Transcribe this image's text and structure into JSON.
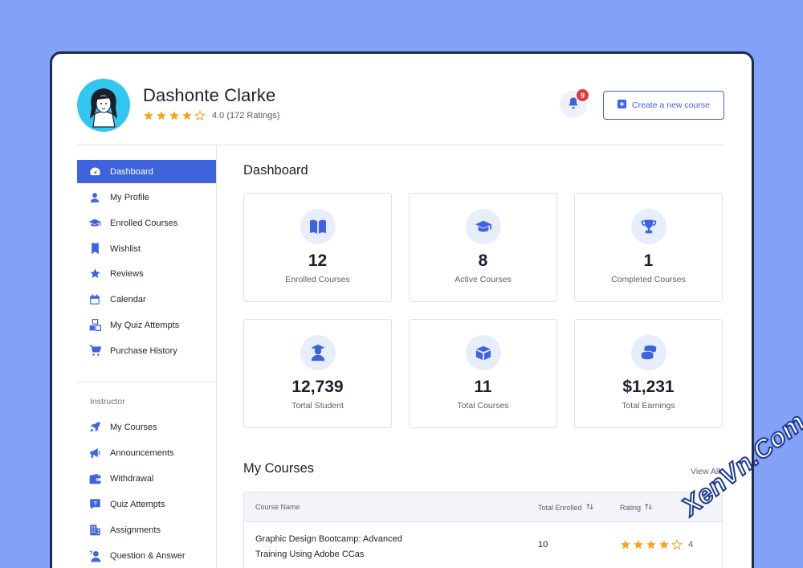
{
  "profile": {
    "name": "Dashonte Clarke",
    "rating_value": 4.0,
    "rating_text": "4.0 (172 Ratings)",
    "avatar_icon": "person-avatar-icon"
  },
  "header": {
    "notification_count": "9",
    "create_course_label": "Create a new course"
  },
  "sidebar": {
    "items": [
      {
        "label": "Dashboard",
        "icon": "gauge-icon",
        "active": true
      },
      {
        "label": "My Profile",
        "icon": "user-icon"
      },
      {
        "label": "Enrolled Courses",
        "icon": "graduation-cap-icon"
      },
      {
        "label": "Wishlist",
        "icon": "bookmark-icon"
      },
      {
        "label": "Reviews",
        "icon": "star-icon"
      },
      {
        "label": "Calendar",
        "icon": "calendar-icon"
      },
      {
        "label": "My Quiz Attempts",
        "icon": "cubes-icon"
      },
      {
        "label": "Purchase History",
        "icon": "cart-icon"
      }
    ],
    "instructor_label": "Instructor",
    "instructor_items": [
      {
        "label": "My Courses",
        "icon": "rocket-icon"
      },
      {
        "label": "Announcements",
        "icon": "megaphone-icon"
      },
      {
        "label": "Withdrawal",
        "icon": "wallet-icon"
      },
      {
        "label": "Quiz Attempts",
        "icon": "question-icon"
      },
      {
        "label": "Assignments",
        "icon": "building-icon"
      },
      {
        "label": "Question & Answer",
        "icon": "person-question-icon"
      }
    ]
  },
  "main": {
    "title": "Dashboard",
    "stats": [
      {
        "value": "12",
        "label": "Enrolled Courses",
        "icon": "book-icon"
      },
      {
        "value": "8",
        "label": "Active Courses",
        "icon": "graduation-cap-icon"
      },
      {
        "value": "1",
        "label": "Completed Courses",
        "icon": "trophy-icon"
      },
      {
        "value": "12,739",
        "label": "Tortal Student",
        "icon": "student-icon"
      },
      {
        "value": "11",
        "label": "Total Courses",
        "icon": "box-icon"
      },
      {
        "value": "$1,231",
        "label": "Total Earnings",
        "icon": "coins-icon"
      }
    ]
  },
  "courses": {
    "title": "My Courses",
    "view_all": "View All",
    "columns": [
      "Course Name",
      "Total Enrolled",
      "Rating"
    ],
    "rows": [
      {
        "name_line1": "Graphic Design Bootcamp: Advanced",
        "name_line2": "Training Using Adobe CCas",
        "enrolled": "10",
        "rating": 4.0,
        "rating_text": "4"
      }
    ]
  },
  "watermark": "XenVn.Com",
  "colors": {
    "accent": "#3e63dd",
    "background": "#83a1f7",
    "star": "#f5a623",
    "badge": "#e03a3a"
  }
}
